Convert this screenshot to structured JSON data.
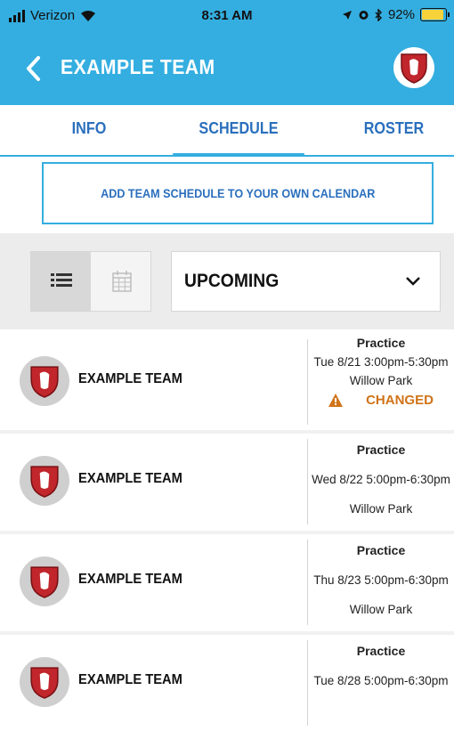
{
  "status_bar": {
    "carrier": "Verizon",
    "time": "8:31 AM",
    "battery": "92%",
    "battery_level": 0.92
  },
  "header": {
    "back_label": "<",
    "title": "EXAMPLE TEAM"
  },
  "tabs": [
    {
      "label": "INFO",
      "active": false
    },
    {
      "label": "SCHEDULE",
      "active": true
    },
    {
      "label": "ROSTER",
      "active": false
    }
  ],
  "add_calendar_label": "ADD TEAM SCHEDULE TO YOUR OWN CALENDAR",
  "filter": {
    "view_modes": [
      "list-view",
      "calendar-view"
    ],
    "selected_view": "list-view",
    "select_value": "UPCOMING"
  },
  "events": [
    {
      "team": "EXAMPLE TEAM",
      "type": "Practice",
      "datetime": "Tue 8/21 3:00pm-5:30pm",
      "location": "Willow Park",
      "status": "CHANGED"
    },
    {
      "team": "EXAMPLE TEAM",
      "type": "Practice",
      "datetime": "Wed 8/22 5:00pm-6:30pm",
      "location": "Willow Park",
      "status": ""
    },
    {
      "team": "EXAMPLE TEAM",
      "type": "Practice",
      "datetime": "Thu 8/23 5:00pm-6:30pm",
      "location": "Willow Park",
      "status": ""
    },
    {
      "team": "EXAMPLE TEAM",
      "type": "Practice",
      "datetime": "Tue 8/28 5:00pm-6:30pm",
      "location": "",
      "status": ""
    }
  ],
  "colors": {
    "accent": "#34aee0",
    "tab_text": "#2a6fbd",
    "changed": "#d07318",
    "crest_red": "#c0262b"
  }
}
